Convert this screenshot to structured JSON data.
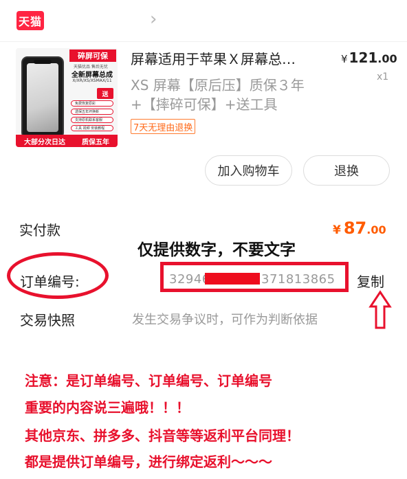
{
  "store": {
    "logo_text": "天猫",
    "chevron_icon": "chevron-right-icon"
  },
  "product": {
    "thumbnail": {
      "badge": "碎屏可保",
      "sub1": "天猫优品 售后无忧",
      "title": "全新屏幕总成",
      "models": "X/XR/XS/XSMAX/11",
      "send": "送",
      "features": [
        "免费恢复原彩",
        "透保五年坏换新",
        "支持原机联系客服",
        "工具 视频 安装教程"
      ],
      "bottom_left": "大部分次日达",
      "bottom_right": "质保五年"
    },
    "title": "屏幕适用于苹果Ｘ屏幕总…",
    "desc_line1": "XS 屏幕【原后压】质保３年",
    "desc_line2": "+【摔碎可保】+送工具",
    "return_tag": "7天无理由退换",
    "price_symbol": "¥",
    "price_int": "121",
    "price_dec": ".00",
    "qty": "x1"
  },
  "buttons": {
    "add_to_cart": "加入购物车",
    "refund": "退换"
  },
  "paid": {
    "label": "实付款",
    "symbol": "¥",
    "int": "87",
    "dec": ".00"
  },
  "overlay_note": "仅提供数字，不要文字",
  "order": {
    "label": "订单编号:",
    "number_part1": "32946",
    "number_part2": "371813865",
    "copy": "复制"
  },
  "snapshot": {
    "label": "交易快照",
    "desc": "发生交易争议时，可作为判断依据"
  },
  "notes": [
    "注意：是订单编号、订单编号、订单编号",
    "重要的内容说三遍哦！！！",
    "其他京东、拼多多、抖音等等返利平台同理！",
    "都是提供订单编号，进行绑定返利～～～"
  ],
  "colors": {
    "accent": "#e8112d",
    "price_orange": "#ff5b00",
    "tag_orange": "#ff6a1a"
  }
}
